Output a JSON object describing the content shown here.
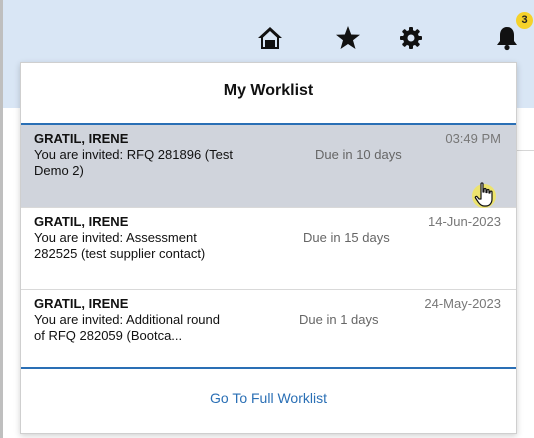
{
  "header": {
    "icons": [
      "home-icon",
      "star-icon",
      "gear-icon",
      "bell-icon"
    ],
    "notification_count": "3"
  },
  "worklist": {
    "title": "My Worklist",
    "items": [
      {
        "name": "GRATIL, IRENE",
        "time": "03:49 PM",
        "description": "You are invited: RFQ 281896 (Test Demo 2)",
        "due": "Due in 10 days",
        "selected": true
      },
      {
        "name": "GRATIL, IRENE",
        "time": "14-Jun-2023",
        "description": "You are invited: Assessment 282525 (test supplier contact)",
        "due": "Due in 15 days",
        "selected": false
      },
      {
        "name": "GRATIL, IRENE",
        "time": "24-May-2023",
        "description": "You are invited: Additional round of RFQ 282059 (Bootca...",
        "due": "Due in 1 days",
        "selected": false
      }
    ],
    "footer_link": "Go To Full Worklist"
  },
  "colors": {
    "accent": "#2a6fb5",
    "badge": "#f5d22b",
    "selected_row": "#d0d4dc",
    "arrow": "#e02020"
  }
}
